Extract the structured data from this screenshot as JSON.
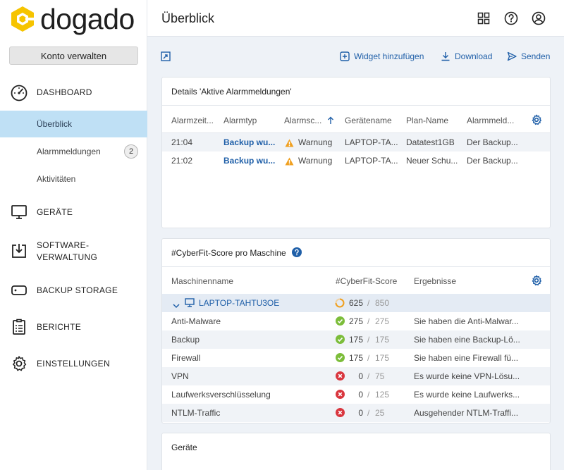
{
  "brand": {
    "name": "dogado",
    "accent": "#f6c400"
  },
  "sidebar": {
    "account_button": "Konto verwalten",
    "dashboard": "DASHBOARD",
    "sub": [
      {
        "label": "Überblick",
        "active": true
      },
      {
        "label": "Alarmmeldungen",
        "badge": "2"
      },
      {
        "label": "Aktivitäten"
      }
    ],
    "geraete": "GERÄTE",
    "software_line1": "SOFTWARE-",
    "software_line2": "VERWALTUNG",
    "backup_storage": "BACKUP STORAGE",
    "berichte": "BERICHTE",
    "einstellungen": "EINSTELLUNGEN"
  },
  "header": {
    "title": "Überblick",
    "icons": [
      "grid-icon",
      "help-icon",
      "user-icon"
    ]
  },
  "toolbar": {
    "widget_add": "Widget hinzufügen",
    "download": "Download",
    "send": "Senden"
  },
  "alarms": {
    "title": "Details 'Aktive Alarmmeldungen'",
    "columns": [
      "Alarmzeit...",
      "Alarmtyp",
      "Alarmsc...",
      "Gerätename",
      "Plan-Name",
      "Alarmmeld..."
    ],
    "rows": [
      {
        "time": "21:04",
        "type": "Backup wu...",
        "severity": "Warnung",
        "device": "LAPTOP-TA...",
        "plan": "Datatest1GB",
        "message": "Der Backup..."
      },
      {
        "time": "21:02",
        "type": "Backup wu...",
        "severity": "Warnung",
        "device": "LAPTOP-TA...",
        "plan": "Neuer Schu...",
        "message": "Der Backup..."
      }
    ]
  },
  "cyberfit": {
    "title": "#CyberFit-Score pro Maschine",
    "columns": [
      "Maschinenname",
      "#CyberFit-Score",
      "Ergebnisse"
    ],
    "machine": {
      "name": "LAPTOP-TAHTU3OE",
      "score": "625",
      "max": "850"
    },
    "rows": [
      {
        "name": "Anti-Malware",
        "status": "ok",
        "score": "275",
        "max": "275",
        "result": "Sie haben die Anti-Malwar..."
      },
      {
        "name": "Backup",
        "status": "ok",
        "score": "175",
        "max": "175",
        "result": "Sie haben eine Backup-Lö..."
      },
      {
        "name": "Firewall",
        "status": "ok",
        "score": "175",
        "max": "175",
        "result": "Sie haben eine Firewall fü..."
      },
      {
        "name": "VPN",
        "status": "fail",
        "score": "0",
        "max": "75",
        "result": "Es wurde keine VPN-Lösu..."
      },
      {
        "name": "Laufwerksverschlüsselung",
        "status": "fail",
        "score": "0",
        "max": "125",
        "result": "Es wurde keine Laufwerks..."
      },
      {
        "name": "NTLM-Traffic",
        "status": "fail",
        "score": "0",
        "max": "25",
        "result": "Ausgehender NTLM-Traffi..."
      }
    ]
  },
  "devices": {
    "title": "Geräte"
  },
  "separator": "/",
  "colors": {
    "link": "#1f5fa8",
    "ok": "#7cbd3a",
    "fail": "#d9363e",
    "warn": "#f0a020",
    "active_bg": "#bfe0f5"
  }
}
